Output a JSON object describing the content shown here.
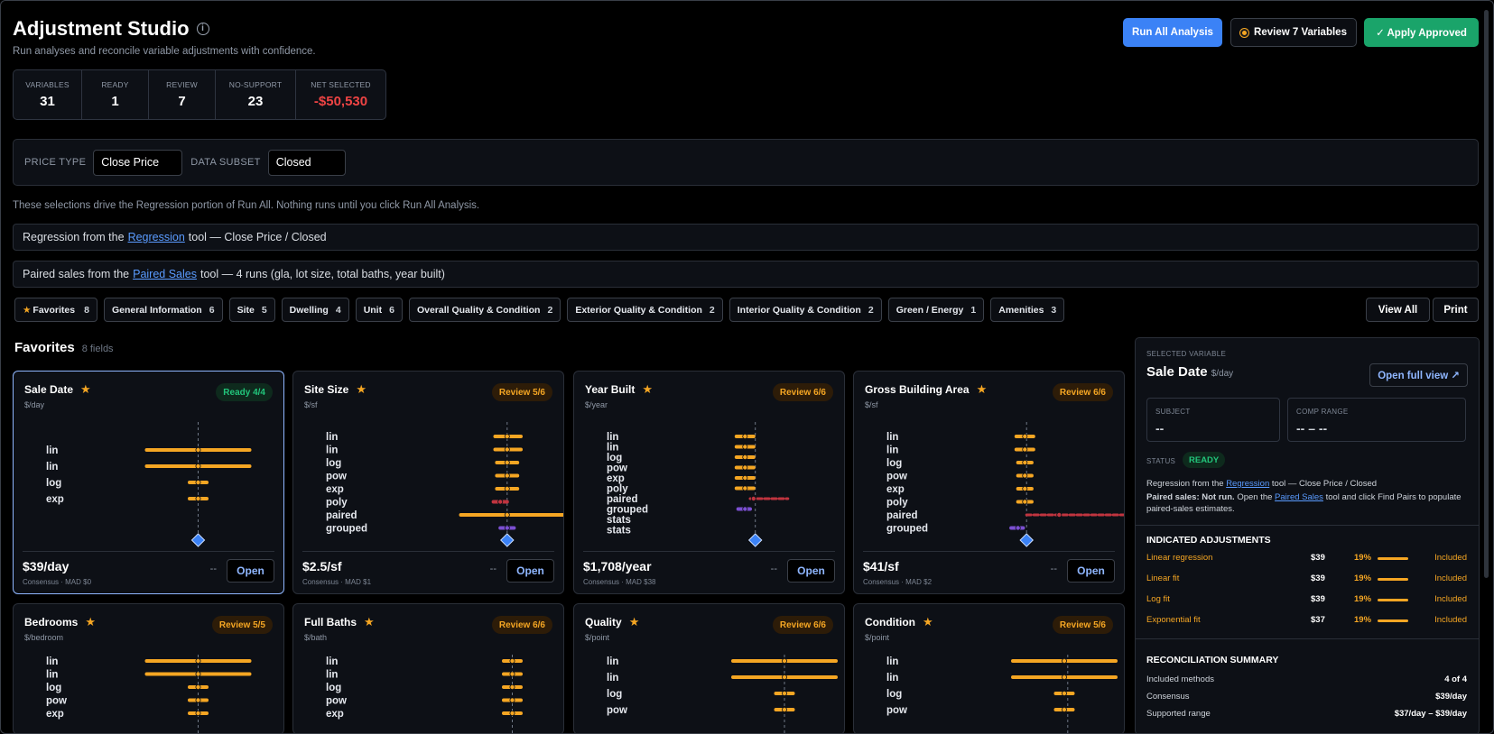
{
  "header": {
    "title": "Adjustment Studio",
    "subtitle": "Run analyses and reconcile variable adjustments with confidence.",
    "run_all": "Run All Analysis",
    "review": "Review 7 Variables",
    "apply": "✓  Apply Approved"
  },
  "stats": [
    {
      "label": "VARIABLES",
      "value": "31"
    },
    {
      "label": "READY",
      "value": "1"
    },
    {
      "label": "REVIEW",
      "value": "7"
    },
    {
      "label": "NO-SUPPORT",
      "value": "23"
    },
    {
      "label": "NET SELECTED",
      "value": "-$50,530"
    }
  ],
  "filters": {
    "price_type_label": "PRICE TYPE",
    "price_type": "Close Price",
    "subset_label": "DATA SUBSET",
    "subset": "Closed"
  },
  "note": "These selections drive the Regression portion of Run All. Nothing runs until you click Run All Analysis.",
  "sources": {
    "reg_pre": "Regression from the",
    "reg_link": "Regression",
    "reg_post": "tool — Close Price / Closed",
    "paired_pre": "Paired sales from the",
    "paired_link": "Paired Sales",
    "paired_post": "tool — 4 runs (gla, lot size, total baths, year built)"
  },
  "categories": [
    {
      "label": "Favorites",
      "count": "8",
      "star": true
    },
    {
      "label": "General Information",
      "count": "6"
    },
    {
      "label": "Site",
      "count": "5"
    },
    {
      "label": "Dwelling",
      "count": "4"
    },
    {
      "label": "Unit",
      "count": "6"
    },
    {
      "label": "Overall Quality & Condition",
      "count": "2"
    },
    {
      "label": "Exterior Quality & Condition",
      "count": "2"
    },
    {
      "label": "Interior Quality & Condition",
      "count": "2"
    },
    {
      "label": "Green / Energy",
      "count": "1"
    },
    {
      "label": "Amenities",
      "count": "3"
    }
  ],
  "actions": {
    "view_all": "View All",
    "print": "Print"
  },
  "section": {
    "title": "Favorites",
    "count": "8 fields"
  },
  "cards": [
    {
      "title": "Sale Date",
      "unit": "$/day",
      "badge": "Ready 4/4",
      "status": "ready",
      "value": "$39/day",
      "sub": "Consensus · MAD $0",
      "dash": "--",
      "open": "Open",
      "rows": [
        {
          "m": "lin",
          "lo": 0.25,
          "hi": 0.85,
          "c": 0.55,
          "k": "o"
        },
        {
          "m": "lin",
          "lo": 0.25,
          "hi": 0.85,
          "c": 0.55,
          "k": "o"
        },
        {
          "m": "log",
          "lo": 0.5,
          "hi": 0.6,
          "c": 0.55,
          "k": "o"
        },
        {
          "m": "exp",
          "lo": 0.5,
          "hi": 0.6,
          "c": 0.55,
          "k": "o"
        }
      ],
      "center": 0.55
    },
    {
      "title": "Site Size",
      "unit": "$/sf",
      "badge": "Review 5/6",
      "status": "review",
      "value": "$2.5/sf",
      "sub": "Consensus · MAD $1",
      "dash": "--",
      "open": "Open",
      "rows": [
        {
          "m": "lin",
          "lo": 0.65,
          "hi": 0.8,
          "c": 0.72,
          "k": "o"
        },
        {
          "m": "lin",
          "lo": 0.65,
          "hi": 0.8,
          "c": 0.72,
          "k": "o"
        },
        {
          "m": "log",
          "lo": 0.66,
          "hi": 0.78,
          "c": 0.72,
          "k": "o"
        },
        {
          "m": "pow",
          "lo": 0.66,
          "hi": 0.78,
          "c": 0.72,
          "k": "o"
        },
        {
          "m": "exp",
          "lo": 0.66,
          "hi": 0.78,
          "c": 0.72,
          "k": "o"
        },
        {
          "m": "poly",
          "lo": 0.64,
          "hi": 0.72,
          "c": 0.68,
          "k": "r"
        },
        {
          "m": "paired",
          "lo": 0.45,
          "hi": 1.05,
          "c": 0.72,
          "k": "o"
        },
        {
          "m": "grouped",
          "lo": 0.68,
          "hi": 0.76,
          "c": 0.72,
          "k": "p"
        }
      ],
      "center": 0.72
    },
    {
      "title": "Year Built",
      "unit": "$/year",
      "badge": "Review 6/6",
      "status": "review",
      "value": "$1,708/year",
      "sub": "Consensus · MAD $38",
      "dash": "--",
      "open": "Open",
      "rows": [
        {
          "m": "lin",
          "lo": 0.42,
          "hi": 0.52,
          "c": 0.47,
          "k": "o"
        },
        {
          "m": "lin",
          "lo": 0.42,
          "hi": 0.52,
          "c": 0.47,
          "k": "o"
        },
        {
          "m": "log",
          "lo": 0.42,
          "hi": 0.52,
          "c": 0.47,
          "k": "o"
        },
        {
          "m": "pow",
          "lo": 0.42,
          "hi": 0.52,
          "c": 0.47,
          "k": "o"
        },
        {
          "m": "exp",
          "lo": 0.42,
          "hi": 0.52,
          "c": 0.47,
          "k": "o"
        },
        {
          "m": "poly",
          "lo": 0.42,
          "hi": 0.52,
          "c": 0.47,
          "k": "o"
        },
        {
          "m": "paired",
          "lo": 0.5,
          "hi": 0.72,
          "c": 0.52,
          "k": "rd"
        },
        {
          "m": "grouped",
          "lo": 0.43,
          "hi": 0.5,
          "c": 0.47,
          "k": "p"
        },
        {
          "m": "stats",
          "lo": 0,
          "hi": 0,
          "c": -1,
          "k": "n"
        },
        {
          "m": "stats",
          "lo": 0,
          "hi": 0,
          "c": -1,
          "k": "n"
        }
      ],
      "center": 0.53
    },
    {
      "title": "Gross Building Area",
      "unit": "$/sf",
      "badge": "Review 6/6",
      "status": "review",
      "value": "$41/sf",
      "sub": "Consensus · MAD $2",
      "dash": "--",
      "open": "Open",
      "rows": [
        {
          "m": "lin",
          "lo": 0.42,
          "hi": 0.52,
          "c": 0.47,
          "k": "o"
        },
        {
          "m": "lin",
          "lo": 0.42,
          "hi": 0.52,
          "c": 0.47,
          "k": "o"
        },
        {
          "m": "log",
          "lo": 0.43,
          "hi": 0.51,
          "c": 0.47,
          "k": "o"
        },
        {
          "m": "pow",
          "lo": 0.43,
          "hi": 0.51,
          "c": 0.47,
          "k": "o"
        },
        {
          "m": "exp",
          "lo": 0.43,
          "hi": 0.51,
          "c": 0.47,
          "k": "o"
        },
        {
          "m": "poly",
          "lo": 0.43,
          "hi": 0.51,
          "c": 0.47,
          "k": "o"
        },
        {
          "m": "paired",
          "lo": 0.48,
          "hi": 1.05,
          "c": 0.67,
          "k": "rd"
        },
        {
          "m": "grouped",
          "lo": 0.39,
          "hi": 0.46,
          "c": 0.43,
          "k": "p"
        }
      ],
      "center": 0.48
    },
    {
      "title": "Bedrooms",
      "unit": "$/bedroom",
      "badge": "Review 5/5",
      "status": "review",
      "value": "",
      "sub": "",
      "dash": "",
      "open": "",
      "rows": [
        {
          "m": "lin",
          "lo": 0.25,
          "hi": 0.85,
          "c": 0.55,
          "k": "o"
        },
        {
          "m": "lin",
          "lo": 0.25,
          "hi": 0.85,
          "c": 0.55,
          "k": "o"
        },
        {
          "m": "log",
          "lo": 0.5,
          "hi": 0.6,
          "c": 0.55,
          "k": "o"
        },
        {
          "m": "pow",
          "lo": 0.5,
          "hi": 0.6,
          "c": 0.55,
          "k": "o"
        },
        {
          "m": "exp",
          "lo": 0.5,
          "hi": 0.6,
          "c": 0.55,
          "k": "o"
        }
      ],
      "center": 0.55
    },
    {
      "title": "Full Baths",
      "unit": "$/bath",
      "badge": "Review 6/6",
      "status": "review",
      "value": "",
      "sub": "",
      "dash": "",
      "open": "",
      "rows": [
        {
          "m": "lin",
          "lo": 0.7,
          "hi": 0.8,
          "c": 0.75,
          "k": "o"
        },
        {
          "m": "lin",
          "lo": 0.7,
          "hi": 0.8,
          "c": 0.75,
          "k": "o"
        },
        {
          "m": "log",
          "lo": 0.7,
          "hi": 0.8,
          "c": 0.75,
          "k": "o"
        },
        {
          "m": "pow",
          "lo": 0.7,
          "hi": 0.8,
          "c": 0.75,
          "k": "o"
        },
        {
          "m": "exp",
          "lo": 0.7,
          "hi": 0.8,
          "c": 0.75,
          "k": "o"
        }
      ],
      "center": 0.75
    },
    {
      "title": "Quality",
      "unit": "$/point",
      "badge": "Review 6/6",
      "status": "review",
      "value": "",
      "sub": "",
      "dash": "",
      "open": "",
      "rows": [
        {
          "m": "lin",
          "lo": 0.4,
          "hi": 1.0,
          "c": 0.7,
          "k": "o"
        },
        {
          "m": "lin",
          "lo": 0.4,
          "hi": 1.0,
          "c": 0.7,
          "k": "o"
        },
        {
          "m": "log",
          "lo": 0.65,
          "hi": 0.75,
          "c": 0.7,
          "k": "o"
        },
        {
          "m": "pow",
          "lo": 0.65,
          "hi": 0.75,
          "c": 0.7,
          "k": "o"
        }
      ],
      "center": 0.7
    },
    {
      "title": "Condition",
      "unit": "$/point",
      "badge": "Review 5/6",
      "status": "review",
      "value": "",
      "sub": "",
      "dash": "",
      "open": "",
      "rows": [
        {
          "m": "lin",
          "lo": 0.4,
          "hi": 1.0,
          "c": 0.7,
          "k": "o"
        },
        {
          "m": "lin",
          "lo": 0.4,
          "hi": 1.0,
          "c": 0.7,
          "k": "o"
        },
        {
          "m": "log",
          "lo": 0.65,
          "hi": 0.75,
          "c": 0.7,
          "k": "o"
        },
        {
          "m": "pow",
          "lo": 0.65,
          "hi": 0.75,
          "c": 0.7,
          "k": "o"
        }
      ],
      "center": 0.72
    }
  ],
  "panel": {
    "eyebrow": "SELECTED VARIABLE",
    "title": "Sale Date",
    "unit": "$/day",
    "open_full": "Open full view ↗",
    "subject_label": "SUBJECT",
    "subject_value": "--",
    "comp_label": "COMP RANGE",
    "comp_value": "-- – --",
    "status_label": "STATUS",
    "status": "READY",
    "reg_pre": "Regression from the",
    "reg_link": "Regression",
    "reg_post": "tool — Close Price / Closed",
    "paired_bold": "Paired sales: Not run.",
    "paired_pre": "Open the",
    "paired_link": "Paired Sales",
    "paired_post": "tool and click Find Pairs to populate paired-sales estimates.",
    "indicated_title": "INDICATED ADJUSTMENTS",
    "adjustments": [
      {
        "method": "Linear regression",
        "value": "$39",
        "pct": "19%",
        "state": "Included",
        "fraction": 0.19
      },
      {
        "method": "Linear fit",
        "value": "$39",
        "pct": "19%",
        "state": "Included",
        "fraction": 0.19
      },
      {
        "method": "Log fit",
        "value": "$39",
        "pct": "19%",
        "state": "Included",
        "fraction": 0.19
      },
      {
        "method": "Exponential fit",
        "value": "$37",
        "pct": "19%",
        "state": "Included",
        "fraction": 0.19
      }
    ],
    "recon_title": "RECONCILIATION SUMMARY",
    "recon": [
      {
        "label": "Included methods",
        "value": "4 of 4"
      },
      {
        "label": "Consensus",
        "value": "$39/day"
      },
      {
        "label": "Supported range",
        "value": "$37/day – $39/day"
      }
    ]
  },
  "colors": {
    "accent": "#3b82f6",
    "ready": "#22c57b",
    "review": "#f5a623",
    "negative": "#ef4444",
    "apply": "#1aa46a"
  }
}
